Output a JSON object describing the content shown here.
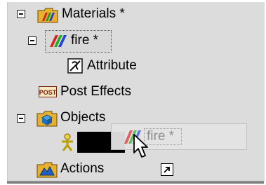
{
  "tree": {
    "materials_label": "Materials *",
    "fire_label": "fire *",
    "attribute_label": "Attribute",
    "post_effects_label": "Post Effects",
    "post_icon_text": "POST",
    "objects_label": "Objects",
    "drag_ghost_label": "fire *",
    "actions_label": "Actions"
  },
  "icons": {
    "toggle": "minus-box-icon",
    "materials": "materials-folder-icon",
    "fire": "rainbow-material-icon",
    "attribute": "attribute-icon",
    "post": "post-effects-icon",
    "objects": "objects-folder-icon",
    "object_item": "person-icon",
    "actions": "actions-folder-icon",
    "cursor": "arrow-cursor-icon",
    "shortcut": "shortcut-arrow-icon"
  },
  "colors": {
    "panel": "#dcdcdc",
    "selection_border": "#555555"
  }
}
